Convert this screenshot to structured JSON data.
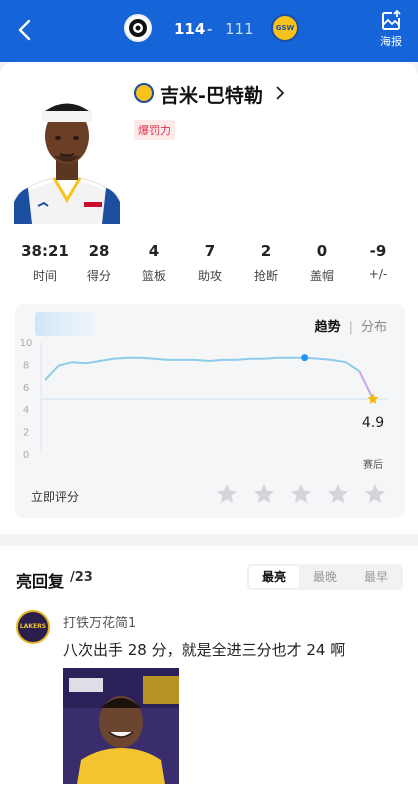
{
  "header": {
    "score_away": "114",
    "score_dash": "-",
    "score_home": "111",
    "home_logo_text": "GSW",
    "poster_label": "海报"
  },
  "player": {
    "name": "吉米-巴特勒",
    "tag": "爆罚力"
  },
  "stats": [
    {
      "value": "38:21",
      "label": "时间"
    },
    {
      "value": "28",
      "label": "得分"
    },
    {
      "value": "4",
      "label": "篮板"
    },
    {
      "value": "7",
      "label": "助攻"
    },
    {
      "value": "2",
      "label": "抢断"
    },
    {
      "value": "0",
      "label": "盖帽"
    },
    {
      "value": "-9",
      "label": "+/-"
    }
  ],
  "rating": {
    "toggle_active": "趋势",
    "toggle_inactive": "分布",
    "rate_label": "立即评分",
    "star_count": 5
  },
  "chart_data": {
    "type": "line",
    "y_ticks": [
      "10",
      "8",
      "6",
      "4",
      "2",
      "0"
    ],
    "ylim": [
      0,
      10
    ],
    "reference_line": 4.9,
    "final_value": "4.9",
    "final_label": "赛后",
    "series": [
      {
        "values": [
          6.6,
          7.9,
          8.2,
          8.1,
          8.3,
          8.5,
          8.6,
          8.6,
          8.5,
          8.4,
          8.4,
          8.4,
          8.3,
          8.4,
          8.4,
          8.5,
          8.5,
          8.6,
          8.6,
          8.6,
          8.5,
          8.4,
          8.2,
          7.4,
          4.9
        ],
        "highlight_index": 19
      }
    ],
    "colors": {
      "line": "#8ecbea",
      "highlight": "#2196f3",
      "final": "#f5b800"
    }
  },
  "comments": {
    "title": "亮回复",
    "count": "/23",
    "sort_tabs": [
      "最亮",
      "最晚",
      "最早"
    ],
    "sort_active": 0,
    "items": [
      {
        "user": "打铁万花简1",
        "avatar_text": "LAKERS",
        "text": "八次出手 28 分，就是全进三分也才 24 啊"
      }
    ]
  }
}
